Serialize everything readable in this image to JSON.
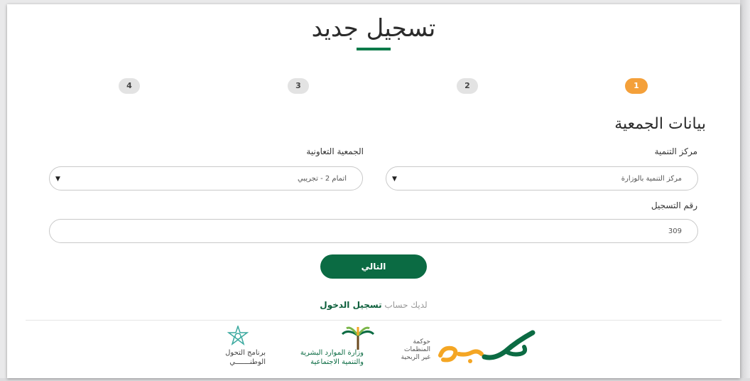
{
  "page": {
    "title": "تسجيل جديد",
    "accent_color": "#0b7a4a",
    "active_step_color": "#f4a03a"
  },
  "steps": [
    {
      "label": "1",
      "active": true
    },
    {
      "label": "2",
      "active": false
    },
    {
      "label": "3",
      "active": false
    },
    {
      "label": "4",
      "active": false
    }
  ],
  "form": {
    "section_title": "بيانات الجمعية",
    "development_center": {
      "label": "مركز التنمية",
      "value": "مركز التنمية بالوزارة",
      "icon": "caret-down-icon"
    },
    "cooperative": {
      "label": "الجمعية التعاونية",
      "value": "اتمام 2 - تجريبي",
      "icon": "caret-down-icon"
    },
    "registration_number": {
      "label": "رقم التسجيل",
      "value": "309"
    },
    "next_button": "التالي"
  },
  "login": {
    "prompt": "لديك حساب",
    "link": "تسجيل الدخول"
  },
  "footer": {
    "logo1": {
      "name": "مكين",
      "line1": "حوكمة",
      "line2": "المنظمات",
      "line3": "غير الربحية"
    },
    "logo2": {
      "line1": "وزارة الموارد البشرية",
      "line2": "والتنمية الاجتماعية"
    },
    "logo3": {
      "line1": "برنامج التحول",
      "line2": "الوطنـــــــي"
    }
  }
}
